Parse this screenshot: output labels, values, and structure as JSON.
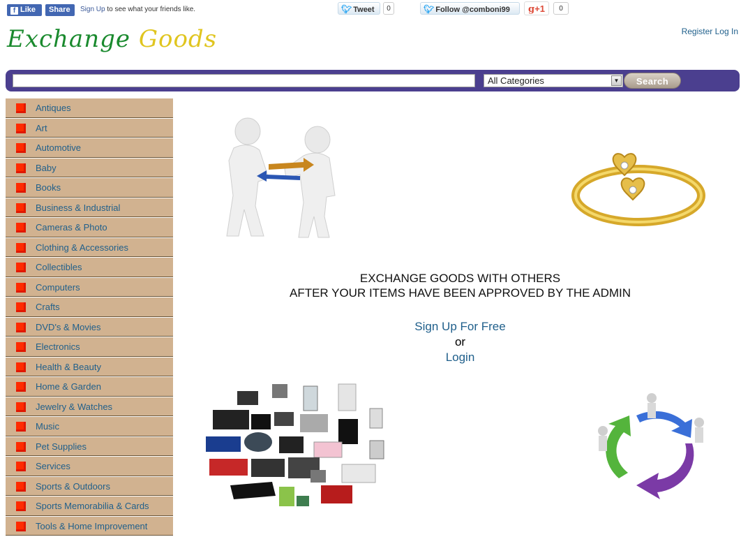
{
  "social": {
    "fb_like": "Like",
    "fb_share": "Share",
    "fb_signup": "Sign Up",
    "fb_text": "to see what your friends like.",
    "tweet": "Tweet",
    "tweet_count": "0",
    "follow": "Follow @comboni99",
    "gplus": "+1",
    "gplus_count": "0"
  },
  "header": {
    "logo_word1": "Exchange",
    "logo_word2": "Goods",
    "register": "Register",
    "login": "Log In"
  },
  "search": {
    "value": "",
    "category": "All Categories",
    "button": "Search"
  },
  "categories": [
    "Antiques",
    "Art",
    "Automotive",
    "Baby",
    "Books",
    "Business & Industrial",
    "Cameras & Photo",
    "Clothing & Accessories",
    "Collectibles",
    "Computers",
    "Crafts",
    "DVD's & Movies",
    "Electronics",
    "Health & Beauty",
    "Home & Garden",
    "Jewelry & Watches",
    "Music",
    "Pet Supplies",
    "Services",
    "Sports & Outdoors",
    "Sports Memorabilia & Cards",
    "Tools & Home Improvement"
  ],
  "main": {
    "headline1": "EXCHANGE GOODS WITH OTHERS",
    "headline2": "AFTER YOUR ITEMS HAVE BEEN APPROVED BY THE ADMIN",
    "signup": "Sign Up For Free",
    "or": "or",
    "login": "Login"
  },
  "colors": {
    "search_bar": "#4b3f8f",
    "sidebar_bg": "#d1b290",
    "category_marker": "#ff2b00",
    "link": "#1f5f8b",
    "logo_green": "#1a8a2e",
    "logo_yellow": "#e0c51f"
  }
}
